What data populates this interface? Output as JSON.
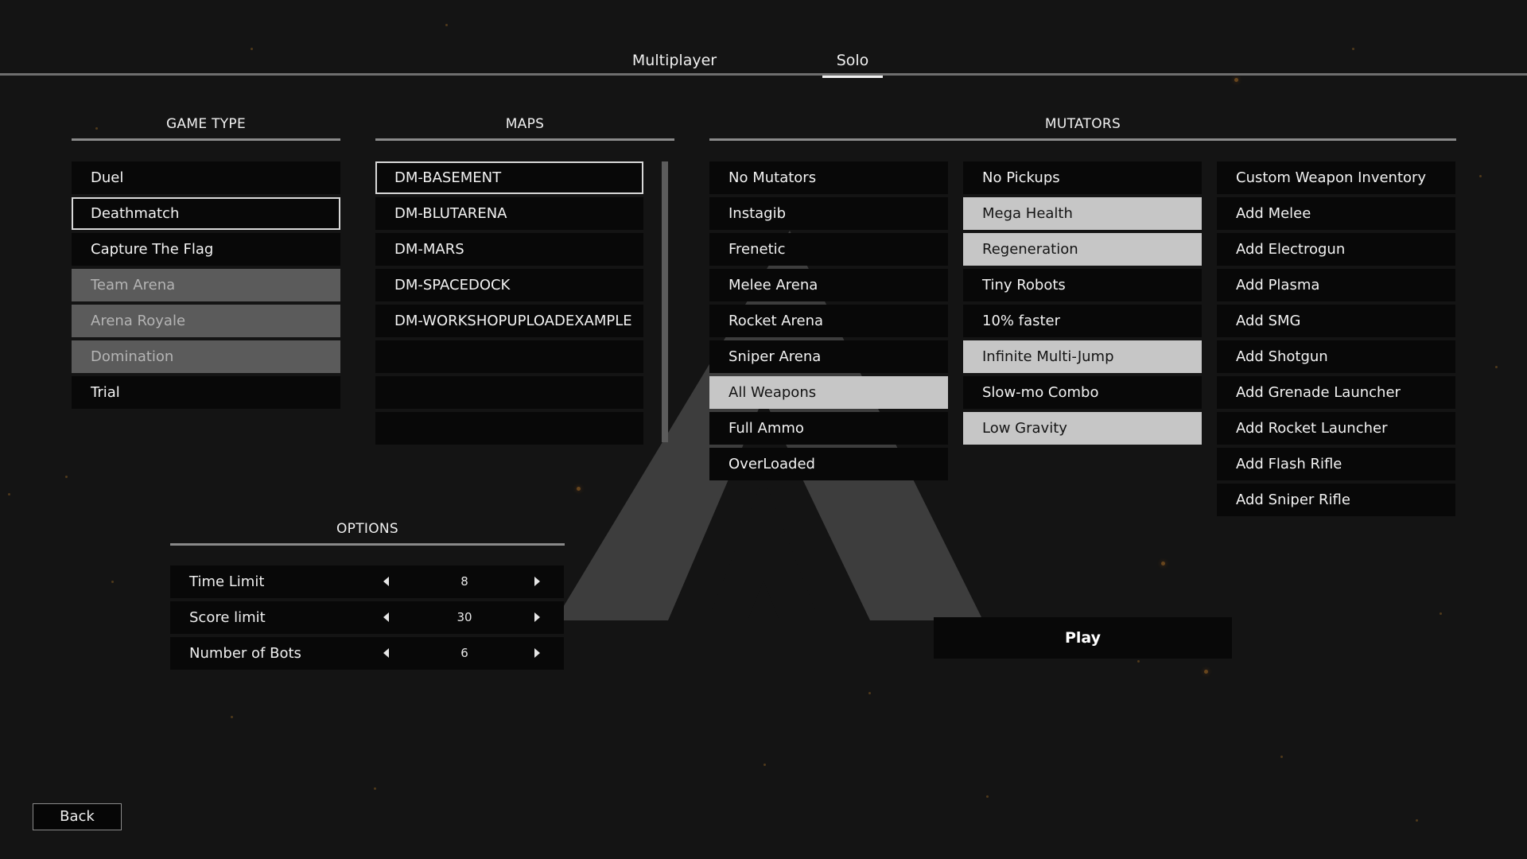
{
  "tabs": [
    {
      "label": "Multiplayer",
      "active": false
    },
    {
      "label": "Solo",
      "active": true
    }
  ],
  "game_type": {
    "title": "GAME TYPE",
    "items": [
      {
        "label": "Duel",
        "state": "normal"
      },
      {
        "label": "Deathmatch",
        "state": "selected"
      },
      {
        "label": "Capture The Flag",
        "state": "normal"
      },
      {
        "label": "Team Arena",
        "state": "disabled"
      },
      {
        "label": "Arena Royale",
        "state": "disabled"
      },
      {
        "label": "Domination",
        "state": "disabled"
      },
      {
        "label": "Trial",
        "state": "normal"
      }
    ]
  },
  "maps": {
    "title": "MAPS",
    "items": [
      {
        "label": "DM-BASEMENT",
        "state": "selected"
      },
      {
        "label": "DM-BLUTARENA",
        "state": "normal"
      },
      {
        "label": "DM-MARS",
        "state": "normal"
      },
      {
        "label": "DM-SPACEDOCK",
        "state": "normal"
      },
      {
        "label": "DM-WORKSHOPUPLOADEXAMPLE",
        "state": "normal"
      },
      {
        "label": "",
        "state": "empty"
      },
      {
        "label": "",
        "state": "empty"
      },
      {
        "label": "",
        "state": "empty"
      }
    ]
  },
  "mutators": {
    "title": "MUTATORS",
    "column1": [
      {
        "label": "No Mutators",
        "on": false
      },
      {
        "label": "Instagib",
        "on": false
      },
      {
        "label": "Frenetic",
        "on": false
      },
      {
        "label": "Melee Arena",
        "on": false
      },
      {
        "label": "Rocket Arena",
        "on": false
      },
      {
        "label": "Sniper Arena",
        "on": false
      },
      {
        "label": "All Weapons",
        "on": true
      },
      {
        "label": "Full Ammo",
        "on": false
      },
      {
        "label": "OverLoaded",
        "on": false
      }
    ],
    "column2": [
      {
        "label": "No Pickups",
        "on": false
      },
      {
        "label": "Mega Health",
        "on": true
      },
      {
        "label": "Regeneration",
        "on": true
      },
      {
        "label": "Tiny Robots",
        "on": false
      },
      {
        "label": "10% faster",
        "on": false
      },
      {
        "label": "Infinite Multi-Jump",
        "on": true
      },
      {
        "label": "Slow-mo Combo",
        "on": false
      },
      {
        "label": "Low Gravity",
        "on": true
      }
    ],
    "column3": [
      {
        "label": "Custom Weapon Inventory",
        "on": false
      },
      {
        "label": "Add Melee",
        "on": false
      },
      {
        "label": "Add Electrogun",
        "on": false
      },
      {
        "label": "Add Plasma",
        "on": false
      },
      {
        "label": "Add SMG",
        "on": false
      },
      {
        "label": "Add Shotgun",
        "on": false
      },
      {
        "label": "Add Grenade Launcher",
        "on": false
      },
      {
        "label": "Add Rocket Launcher",
        "on": false
      },
      {
        "label": "Add Flash Rifle",
        "on": false
      },
      {
        "label": "Add Sniper Rifle",
        "on": false
      }
    ]
  },
  "options": {
    "title": "OPTIONS",
    "rows": [
      {
        "label": "Time Limit",
        "value": "8"
      },
      {
        "label": "Score limit",
        "value": "30"
      },
      {
        "label": "Number of Bots",
        "value": "6"
      }
    ]
  },
  "play_label": "Play",
  "back_label": "Back",
  "colors": {
    "background": "#141414",
    "item_bg": "#080808",
    "disabled_bg": "#5b5b5b",
    "active_mutator_bg": "#c6c6c6",
    "accent_star": "#8a5a22"
  },
  "icons": [
    "arrow-left-icon",
    "arrow-right-icon",
    "game-logo-icon"
  ]
}
